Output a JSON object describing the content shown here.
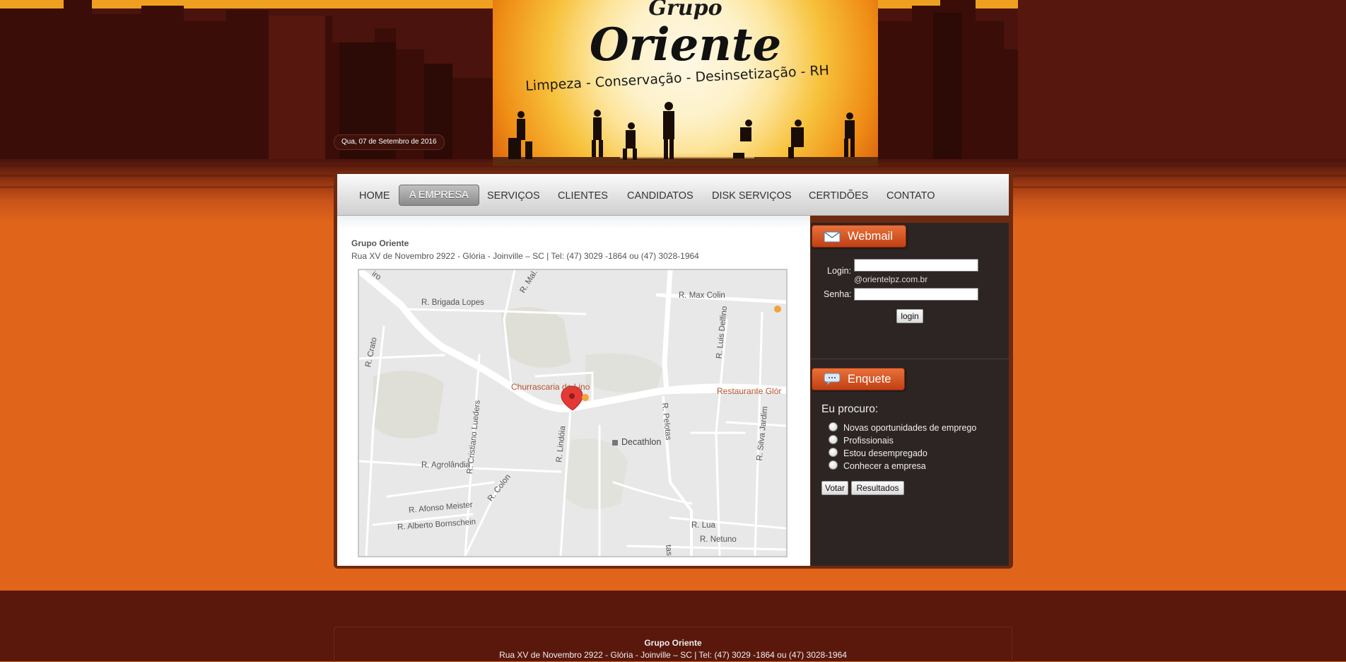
{
  "header": {
    "logo_line1": "Grupo",
    "logo_line2": "Oriente",
    "tagline": "Limpeza - Conservação - Desinsetização - RH",
    "date": "Qua, 07 de Setembro de 2016"
  },
  "nav": {
    "items": [
      "HOME",
      "A EMPRESA",
      "SERVIÇOS",
      "CLIENTES",
      "CANDIDATOS",
      "DISK SERVIÇOS",
      "CERTIDÕES",
      "CONTATO"
    ],
    "active": "A EMPRESA"
  },
  "content": {
    "company_name": "Grupo Oriente",
    "address": "Rua XV de Novembro 2922 - Glória - Joinville – SC | Tel: (47) 3029 -1864 ou (47) 3028-1964"
  },
  "map": {
    "labels": {
      "brigada": "R. Brigada Lopes",
      "mal": "R. Mal.",
      "max_colin": "R. Max Colin",
      "crato": "R. Crato",
      "luis_delfino": "R. Luis Delfino",
      "churrascaria": "Churrascaria do Lino",
      "restaurante": "Restaurante Glór",
      "cristiano": "R. Cristiano Lueders",
      "lindoia": "R. Lindóia",
      "pelotas": "R. Pelotas",
      "silva_jardim": "R. Silva Jardim",
      "decathlon": "Decathlon",
      "agrolandia": "R. Agrolândia",
      "colon": "R. Colon",
      "afonso": "R. Afonso Meister",
      "alberto": "R. Alberto Bornschein",
      "lua": "R. Lua",
      "netuno": "R. Netuno",
      "corner": "iro",
      "tas": "tas"
    }
  },
  "webmail": {
    "title": "Webmail",
    "login_label": "Login:",
    "domain": "@orientelpz.com.br",
    "password_label": "Senha:",
    "login_value": "",
    "password_value": "",
    "button": "login"
  },
  "poll": {
    "title": "Enquete",
    "question": "Eu procuro:",
    "options": [
      "Novas oportunidades de emprego",
      "Profissionais",
      "Estou desempregado",
      "Conhecer a empresa"
    ],
    "vote_button": "Votar",
    "results_button": "Resultados"
  },
  "footer": {
    "name": "Grupo Oriente",
    "address": "Rua XV de Novembro 2922 - Glória - Joinville – SC | Tel: (47) 3029 -1864 ou (47) 3028-1964"
  },
  "colors": {
    "page_orange": "#e0651b",
    "header_brown": "#4a130d",
    "sidebar_dark": "#2d2523",
    "badge_red": "#c13f14",
    "pin_red": "#e53935"
  }
}
